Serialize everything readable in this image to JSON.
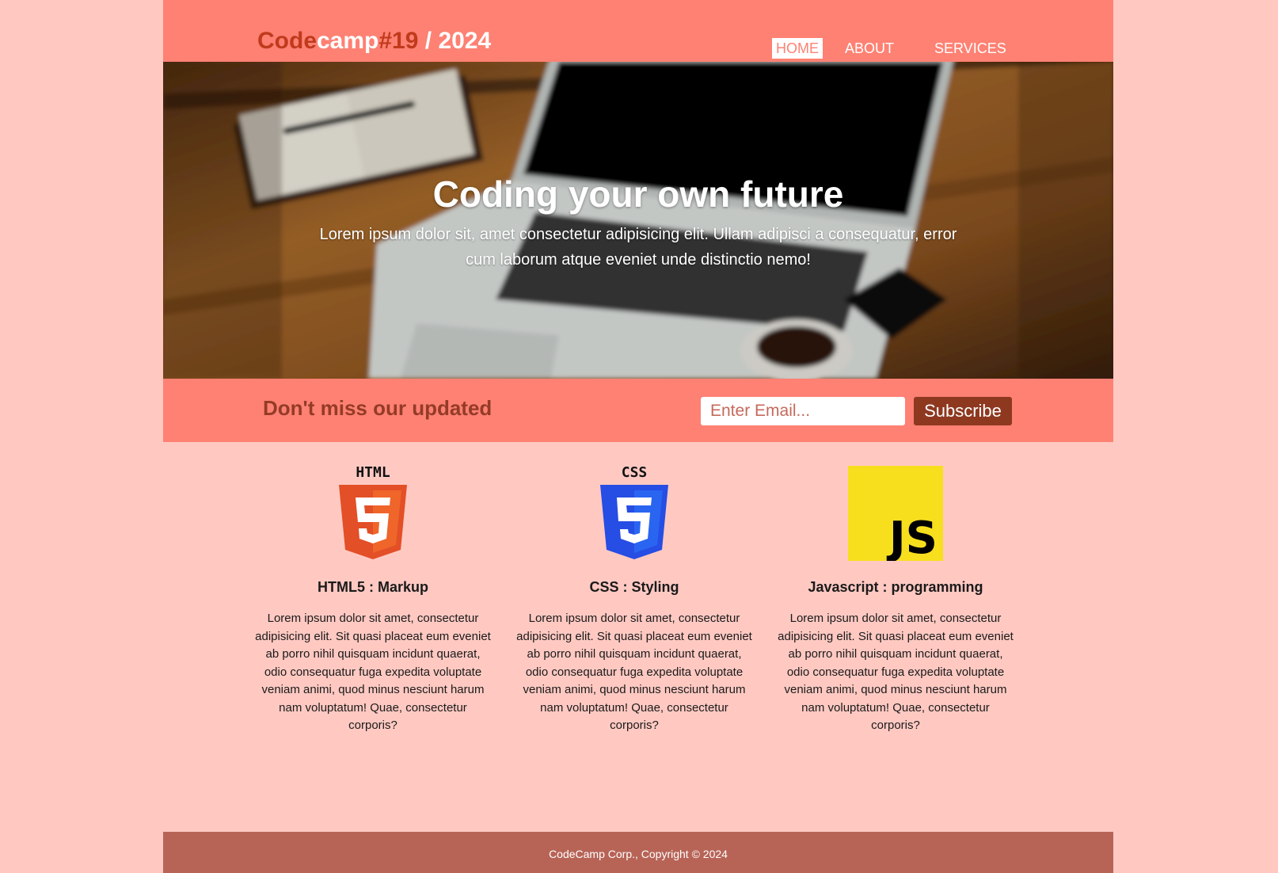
{
  "header": {
    "logo_part1": "Code",
    "logo_part2": "camp",
    "logo_part3": "#19",
    "logo_part4": " / 2024",
    "nav": [
      {
        "label": "HOME",
        "active": true
      },
      {
        "label": "ABOUT",
        "active": false
      },
      {
        "label": "SERVICES",
        "active": false
      }
    ]
  },
  "hero": {
    "title": "Coding your own future",
    "text": "Lorem ipsum dolor sit, amet consectetur adipisicing elit. Ullam adipisci a consequatur, error cum laborum atque eveniet unde distinctio nemo!"
  },
  "newsletter": {
    "title": "Don't miss our updated",
    "email_placeholder": "Enter Email...",
    "button_label": "Subscribe"
  },
  "features": [
    {
      "icon": "html5-logo-icon",
      "icon_caption": "HTML",
      "title": "HTML5 : Markup",
      "text": "Lorem ipsum dolor sit amet, consectetur adipisicing elit. Sit quasi placeat eum eveniet ab porro nihil quisquam incidunt quaerat, odio consequatur fuga expedita voluptate veniam animi, quod minus nesciunt harum nam voluptatum! Quae, consectetur corporis?"
    },
    {
      "icon": "css3-logo-icon",
      "icon_caption": "CSS",
      "title": "CSS : Styling",
      "text": "Lorem ipsum dolor sit amet, consectetur adipisicing elit. Sit quasi placeat eum eveniet ab porro nihil quisquam incidunt quaerat, odio consequatur fuga expedita voluptate veniam animi, quod minus nesciunt harum nam voluptatum! Quae, consectetur corporis?"
    },
    {
      "icon": "javascript-logo-icon",
      "icon_caption": "JS",
      "title": "Javascript : programming",
      "text": "Lorem ipsum dolor sit amet, consectetur adipisicing elit. Sit quasi placeat eum eveniet ab porro nihil quisquam incidunt quaerat, odio consequatur fuga expedita voluptate veniam animi, quod minus nesciunt harum nam voluptatum! Quae, consectetur corporis?"
    }
  ],
  "footer": {
    "text": "CodeCamp Corp., Copyright © 2024"
  },
  "colors": {
    "page_bg": "#ffc9c2",
    "header_bg": "#fe8173",
    "accent_dark": "#c03a1c",
    "button_bg": "#8e3820",
    "footer_bg": "#b76457",
    "html5_orange": "#e34f26",
    "css3_blue": "#264de4",
    "js_yellow": "#f7df1e"
  }
}
